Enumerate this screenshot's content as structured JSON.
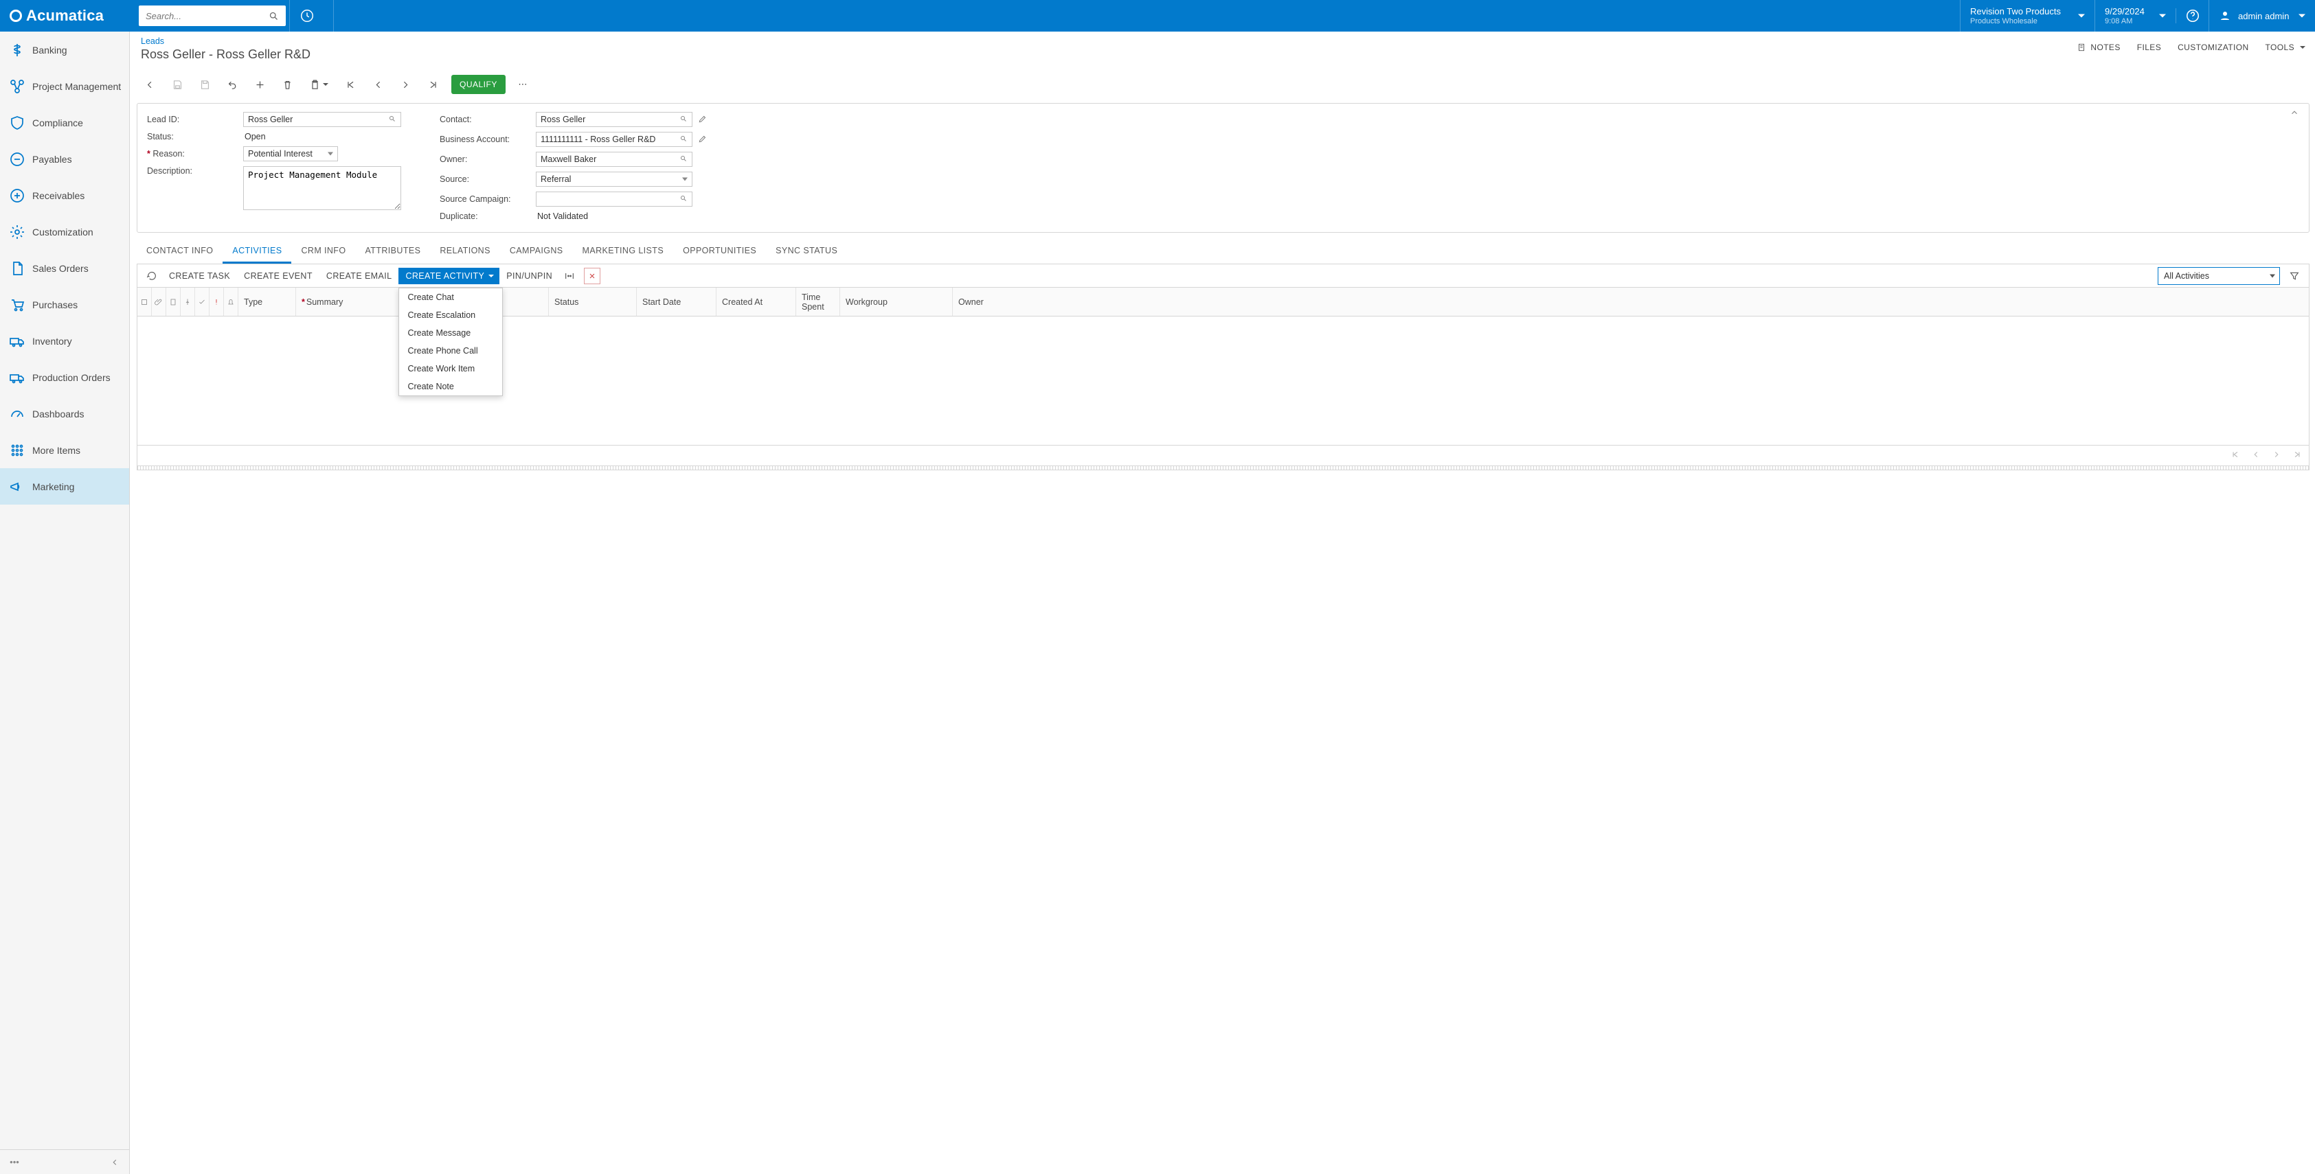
{
  "app_name": "Acumatica",
  "search": {
    "placeholder": "Search..."
  },
  "tenant": {
    "title": "Revision Two Products",
    "subtitle": "Products Wholesale"
  },
  "clock": {
    "date": "9/29/2024",
    "time": "9:08 AM"
  },
  "user": {
    "name": "admin admin"
  },
  "sidebar": {
    "items": [
      {
        "label": "Banking"
      },
      {
        "label": "Project Management"
      },
      {
        "label": "Compliance"
      },
      {
        "label": "Payables"
      },
      {
        "label": "Receivables"
      },
      {
        "label": "Customization"
      },
      {
        "label": "Sales Orders"
      },
      {
        "label": "Purchases"
      },
      {
        "label": "Inventory"
      },
      {
        "label": "Production Orders"
      },
      {
        "label": "Dashboards"
      },
      {
        "label": "More Items"
      },
      {
        "label": "Marketing"
      }
    ]
  },
  "page": {
    "breadcrumb": "Leads",
    "title": "Ross Geller - Ross Geller R&D",
    "right_tools": {
      "notes": "NOTES",
      "files": "FILES",
      "customization": "CUSTOMIZATION",
      "tools": "TOOLS"
    },
    "qualify": "QUALIFY"
  },
  "form": {
    "left": {
      "lead_id_label": "Lead ID:",
      "lead_id": "Ross Geller",
      "status_label": "Status:",
      "status": "Open",
      "reason_label": "Reason:",
      "reason": "Potential Interest",
      "description_label": "Description:",
      "description": "Project Management Module"
    },
    "right": {
      "contact_label": "Contact:",
      "contact": "Ross Geller",
      "ba_label": "Business Account:",
      "ba": "1111111111 - Ross Geller R&D",
      "owner_label": "Owner:",
      "owner": "Maxwell Baker",
      "source_label": "Source:",
      "source": "Referral",
      "sc_label": "Source Campaign:",
      "sc": "",
      "dup_label": "Duplicate:",
      "dup": "Not Validated"
    }
  },
  "tabs": {
    "items": [
      "CONTACT INFO",
      "ACTIVITIES",
      "CRM INFO",
      "ATTRIBUTES",
      "RELATIONS",
      "CAMPAIGNS",
      "MARKETING LISTS",
      "OPPORTUNITIES",
      "SYNC STATUS"
    ],
    "active": 1
  },
  "grid_toolbar": {
    "create_task": "CREATE TASK",
    "create_event": "CREATE EVENT",
    "create_email": "CREATE EMAIL",
    "create_activity": "CREATE ACTIVITY",
    "pin_unpin": "PIN/UNPIN",
    "all_activities": "All Activities",
    "menu": [
      "Create Chat",
      "Create Escalation",
      "Create Message",
      "Create Phone Call",
      "Create Work Item",
      "Create Note"
    ]
  },
  "grid_columns": {
    "type": "Type",
    "summary": "Summary",
    "status": "Status",
    "start_date": "Start Date",
    "created_at": "Created At",
    "time_spent": "Time Spent",
    "workgroup": "Workgroup",
    "owner": "Owner"
  }
}
